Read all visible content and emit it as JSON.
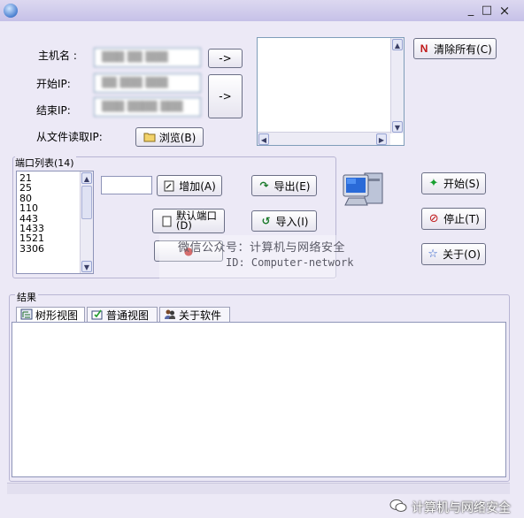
{
  "window": {
    "controls": [
      "_",
      "□",
      "×"
    ]
  },
  "top": {
    "host_label": "主机名 :",
    "host_value": "▒▒▒ ▒▒ ▒▒▒",
    "start_ip_label": "开始IP:",
    "start_ip_value": "▒▒ ▒▒▒ ▒▒▒",
    "end_ip_label": "结束IP:",
    "end_ip_value": "▒▒▒ ▒▒▒▒ ▒▒▒",
    "from_file_label": "从文件读取IP:",
    "arrow_button": "->",
    "arrow_button2": "->",
    "browse_button": "浏览(B)"
  },
  "clear_all_button": "清除所有(C)",
  "ports": {
    "group_label": "端口列表(14)",
    "items": [
      "21",
      "25",
      "80",
      "110",
      "443",
      "1433",
      "1521",
      "3306"
    ],
    "add_button": "增加(A)",
    "default_button_line1": "默认端口",
    "default_button_line2": "(D)",
    "export_button": "导出(E)",
    "import_button": "导入(I)"
  },
  "actions": {
    "start": "开始(S)",
    "stop": "停止(T)",
    "about": "关于(O)"
  },
  "results": {
    "group_label": "结果",
    "tabs": [
      "树形视图",
      "普通视图",
      "关于软件"
    ]
  },
  "watermark": {
    "line1": "微信公众号：计算机与网络安全",
    "line2": "ID: Computer-network",
    "bottom": "计算机与网络安全"
  }
}
